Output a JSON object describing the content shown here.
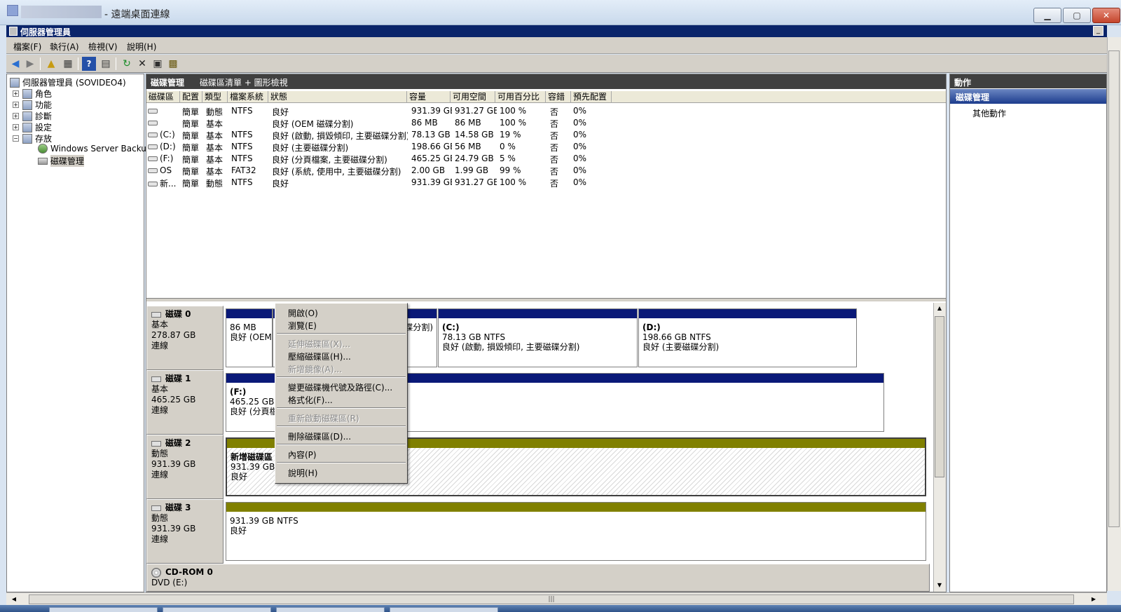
{
  "rdp": {
    "title": "- 遠端桌面連線",
    "minimize": "▁",
    "maximize": "▢",
    "close": "✕"
  },
  "window": {
    "title": "伺服器管理員",
    "min": "_"
  },
  "menu": [
    "檔案(F)",
    "執行(A)",
    "檢視(V)",
    "說明(H)"
  ],
  "toolbar": {
    "icons": [
      "back-arrow-icon",
      "forward-arrow-icon",
      "up-folder-icon",
      "show-hide-tree-icon",
      "help-icon",
      "properties-view-icon",
      "refresh-icon",
      "delete-icon",
      "properties-icon",
      "export-icon"
    ]
  },
  "tree": {
    "root": "伺服器管理員 (SOVIDEO4)",
    "items": [
      "角色",
      "功能",
      "診斷",
      "設定",
      "存放"
    ],
    "storage_children": [
      "Windows Server Backup",
      "磁碟管理"
    ]
  },
  "center": {
    "title": "磁碟管理",
    "subtitle": "磁碟區清單 + 圖形檢視",
    "columns": [
      "磁碟區",
      "配置",
      "類型",
      "檔案系統",
      "狀態",
      "容量",
      "可用空間",
      "可用百分比",
      "容錯",
      "預先配置"
    ],
    "rows": [
      [
        "",
        "簡單",
        "動態",
        "NTFS",
        "良好",
        "931.39 GB",
        "931.27 GB",
        "100 %",
        "否",
        "0%"
      ],
      [
        "",
        "簡單",
        "基本",
        "",
        "良好 (OEM 磁碟分割)",
        "86 MB",
        "86 MB",
        "100 %",
        "否",
        "0%"
      ],
      [
        "(C:)",
        "簡單",
        "基本",
        "NTFS",
        "良好 (啟動, 損毀傾印, 主要磁碟分割)",
        "78.13 GB",
        "14.58 GB",
        "19 %",
        "否",
        "0%"
      ],
      [
        "(D:)",
        "簡單",
        "基本",
        "NTFS",
        "良好 (主要磁碟分割)",
        "198.66 GB",
        "56 MB",
        "0 %",
        "否",
        "0%"
      ],
      [
        "(F:)",
        "簡單",
        "基本",
        "NTFS",
        "良好 (分頁檔案, 主要磁碟分割)",
        "465.25 GB",
        "24.79 GB",
        "5 %",
        "否",
        "0%"
      ],
      [
        "OS",
        "簡單",
        "基本",
        "FAT32",
        "良好 (系統, 使用中, 主要磁碟分割)",
        "2.00 GB",
        "1.99 GB",
        "99 %",
        "否",
        "0%"
      ],
      [
        "新...",
        "簡單",
        "動態",
        "NTFS",
        "良好",
        "931.39 GB",
        "931.27 GB",
        "100 %",
        "否",
        "0%"
      ]
    ]
  },
  "disks": [
    {
      "name": "磁碟 0",
      "type": "基本",
      "size": "278.87 GB",
      "status": "連線",
      "parts": [
        {
          "label": "",
          "size": "86 MB",
          "status": "良好 (OEM"
        },
        {
          "label": "",
          "size": "",
          "status": "碟分割)"
        },
        {
          "label": "(C:)",
          "size": "78.13 GB NTFS",
          "status": "良好 (啟動, 損毀傾印, 主要磁碟分割)"
        },
        {
          "label": "(D:)",
          "size": "198.66 GB NTFS",
          "status": "良好 (主要磁碟分割)"
        }
      ]
    },
    {
      "name": "磁碟 1",
      "type": "基本",
      "size": "465.25 GB",
      "status": "連線",
      "parts": [
        {
          "label": "(F:)",
          "size": "465.25 GB N",
          "status": "良好 (分頁檔"
        }
      ]
    },
    {
      "name": "磁碟 2",
      "type": "動態",
      "size": "931.39 GB",
      "status": "連線",
      "parts": [
        {
          "label": "新增磁碟區",
          "size": "931.39 GB N",
          "status": "良好"
        }
      ]
    },
    {
      "name": "磁碟 3",
      "type": "動態",
      "size": "931.39 GB",
      "status": "連線",
      "parts": [
        {
          "label": "",
          "size": "931.39 GB NTFS",
          "status": "良好"
        }
      ]
    },
    {
      "name": "CD-ROM 0",
      "type": "DVD (E:)",
      "size": "",
      "status": ""
    }
  ],
  "actions": {
    "header": "動作",
    "section": "磁碟管理",
    "other": "其他動作"
  },
  "context_menu": {
    "items": [
      {
        "label": "開啟(O)",
        "enabled": true
      },
      {
        "label": "瀏覽(E)",
        "enabled": true
      },
      {
        "label": "延伸磁碟區(X)...",
        "enabled": false
      },
      {
        "label": "壓縮磁碟區(H)...",
        "enabled": true
      },
      {
        "label": "新增鏡像(A)...",
        "enabled": false
      },
      {
        "label": "變更磁碟機代號及路徑(C)...",
        "enabled": true
      },
      {
        "label": "格式化(F)...",
        "enabled": true
      },
      {
        "label": "重新啟動磁碟區(R)",
        "enabled": false
      },
      {
        "label": "刪除磁碟區(D)...",
        "enabled": true
      },
      {
        "label": "內容(P)",
        "enabled": true
      },
      {
        "label": "說明(H)",
        "enabled": true
      }
    ]
  },
  "scroll": {
    "grip": "|||"
  },
  "colors": {
    "primary_partition": "#0a1978",
    "dynamic_volume": "#808000",
    "title_bar": "#0a246a"
  }
}
